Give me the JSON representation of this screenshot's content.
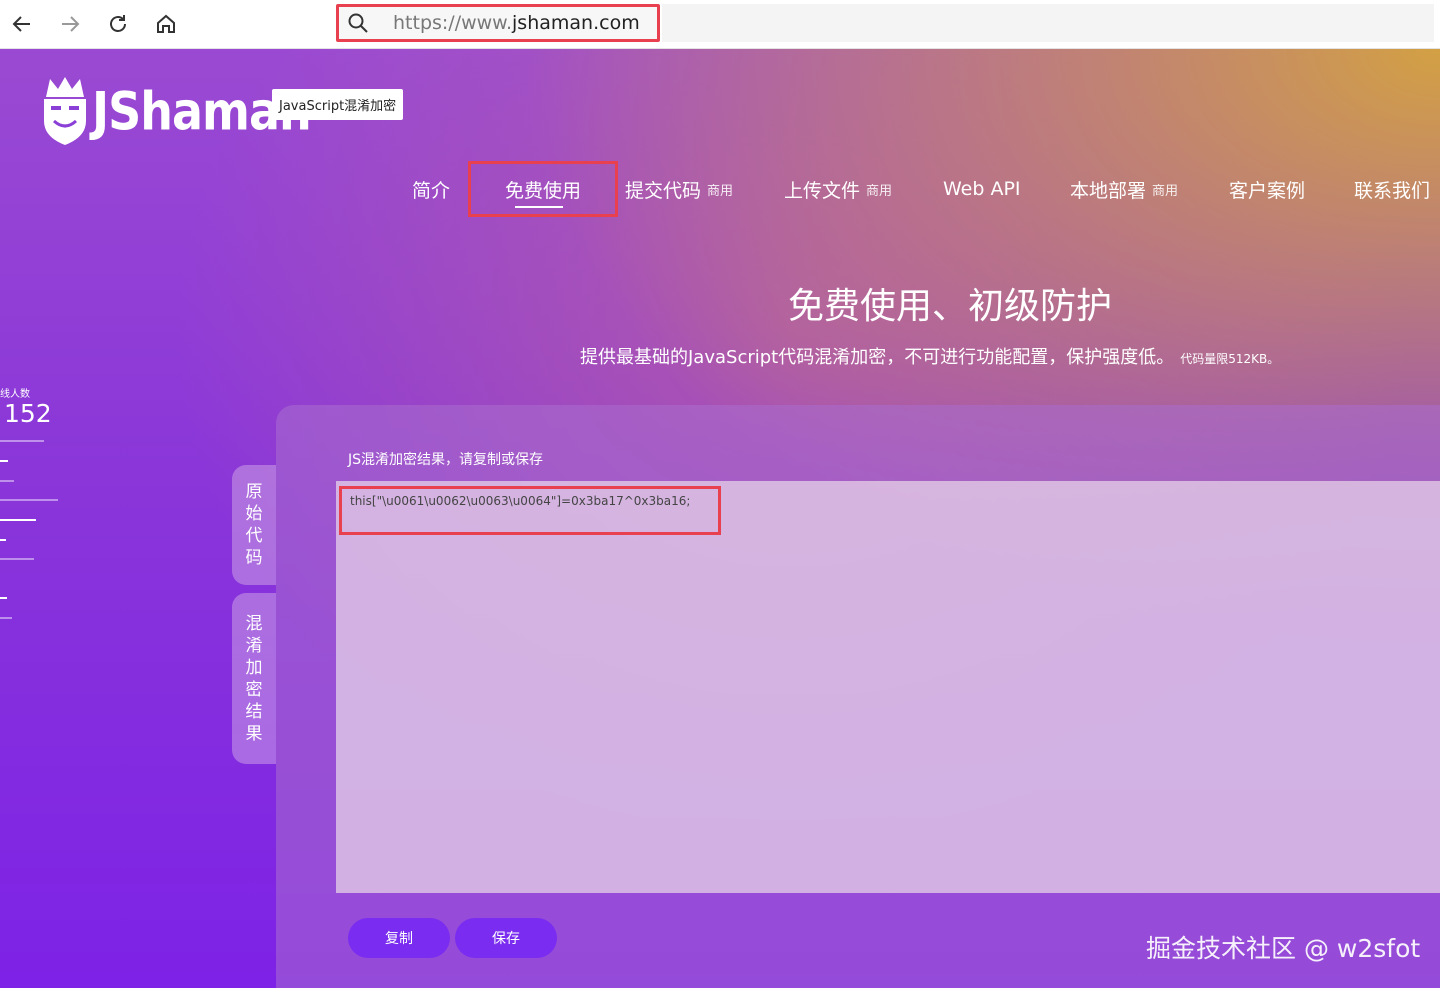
{
  "browser": {
    "url_prefix": "https://www.",
    "url_domain": "jshaman.com"
  },
  "logo": {
    "text": "JShaman",
    "badge": "JavaScript混淆加密"
  },
  "menu": [
    {
      "label": "简介",
      "tag": ""
    },
    {
      "label": "免费使用",
      "tag": ""
    },
    {
      "label": "提交代码",
      "tag": "商用"
    },
    {
      "label": "上传文件",
      "tag": "商用"
    },
    {
      "label": "Web API",
      "tag": ""
    },
    {
      "label": "本地部署",
      "tag": "商用"
    },
    {
      "label": "客户案例",
      "tag": ""
    },
    {
      "label": "联系我们",
      "tag": ""
    }
  ],
  "hero": {
    "title": "免费使用、初级防护",
    "subtitle": "提供最基础的JavaScript代码混淆加密，不可进行功能配置，保护强度低。",
    "limit_note": "代码量限512KB。"
  },
  "stats": {
    "label": "线人数",
    "value": "152"
  },
  "tabs": {
    "original": "原始代码",
    "result": "混淆加密结果"
  },
  "result": {
    "label": "JS混淆加密结果，请复制或保存",
    "code": "this[\"\\u0061\\u0062\\u0063\\u0064\"]=0x3ba17^0x3ba16;"
  },
  "buttons": {
    "copy": "复制",
    "save": "保存"
  },
  "watermark": "掘金技术社区 @ w2sfot",
  "colors": {
    "highlight": "#e8404f",
    "button": "#7a2cf0"
  }
}
